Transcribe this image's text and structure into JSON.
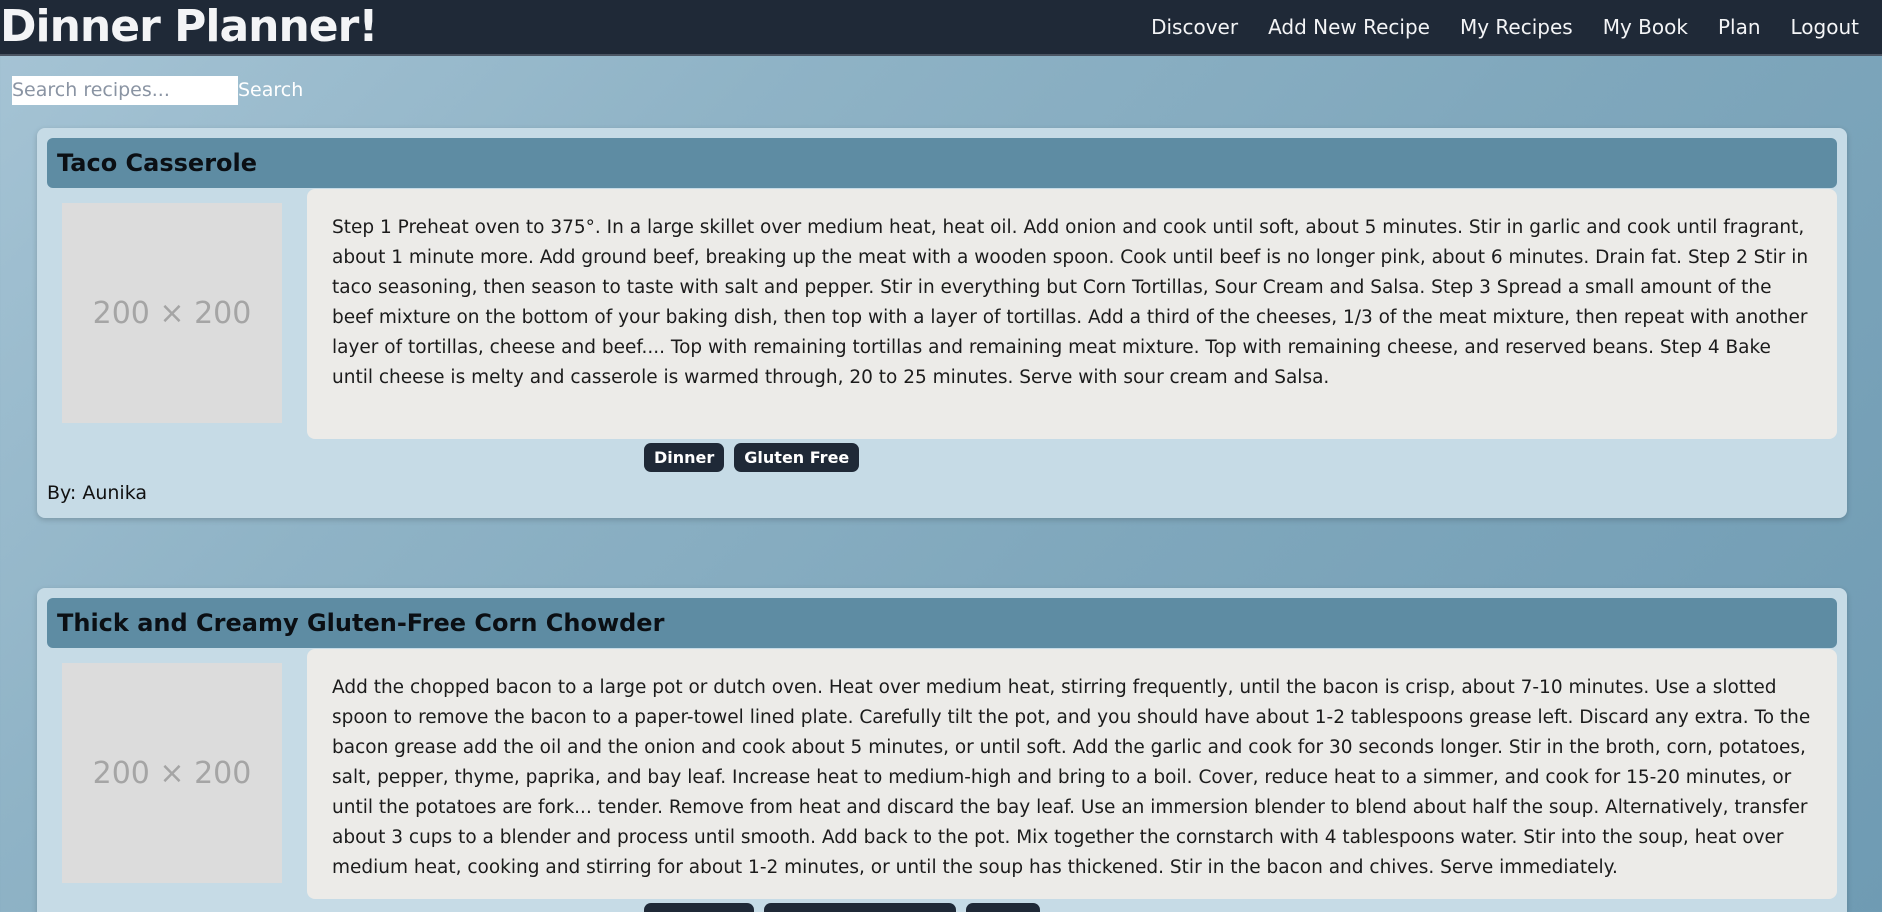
{
  "nav": {
    "brand": "Dinner Planner!",
    "links": [
      "Discover",
      "Add New Recipe",
      "My Recipes",
      "My Book",
      "Plan",
      "Logout"
    ]
  },
  "search": {
    "placeholder": "Search recipes...",
    "button_label": "Search"
  },
  "recipes": [
    {
      "title": "Taco Casserole",
      "image_label": "200 × 200",
      "steps": "Step 1 Preheat oven to 375°. In a large skillet over medium heat, heat oil. Add onion and cook until soft, about 5 minutes. Stir in garlic and cook until fragrant, about 1 minute more. Add ground beef, breaking up the meat with a wooden spoon. Cook until beef is no longer pink, about 6 minutes. Drain fat. Step 2 Stir in taco seasoning, then season to taste with salt and pepper. Stir in everything but Corn Tortillas, Sour Cream and Salsa. Step 3 Spread a small amount of the beef mixture on the bottom of your baking dish, then top with a layer of tortillas. Add a third of the cheeses, 1/3 of the meat mixture, then repeat with another layer of tortillas, cheese and beef.... Top with remaining tortillas and remaining meat mixture. Top with remaining cheese, and reserved beans. Step 4 Bake until cheese is melty and casserole is warmed through, 20 to 25 minutes. Serve with sour cream and Salsa.",
      "tags": [
        "Dinner",
        "Gluten Free"
      ],
      "author": "By: Aunika"
    },
    {
      "title": "Thick and Creamy Gluten-Free Corn Chowder",
      "image_label": "200 × 200",
      "steps": "Add the chopped bacon to a large pot or dutch oven. Heat over medium heat, stirring frequently, until the bacon is crisp, about 7-10 minutes. Use a slotted spoon to remove the bacon to a paper-towel lined plate. Carefully tilt the pot, and you should have about 1-2 tablespoons grease left. Discard any extra. To the bacon grease add the oil and the onion and cook about 5 minutes, or until soft. Add the garlic and cook for 30 seconds longer. Stir in the broth, corn, potatoes, salt, pepper, thyme, paprika, and bay leaf. Increase heat to medium-high and bring to a boil. Cover, reduce heat to a simmer, and cook for 15-20 minutes, or until the potatoes are fork... tender. Remove from heat and discard the bay leaf. Use an immersion blender to blend about half the soup. Alternatively, transfer about 3 cups to a blender and process until smooth. Add back to the pot. Mix together the cornstarch with 4 tablespoons water. Stir into the soup, heat over medium heat, cooking and stirring for about 1-2 minutes, or until the soup has thickened. Stir in the bacon and chives. Serve immediately."
    }
  ]
}
